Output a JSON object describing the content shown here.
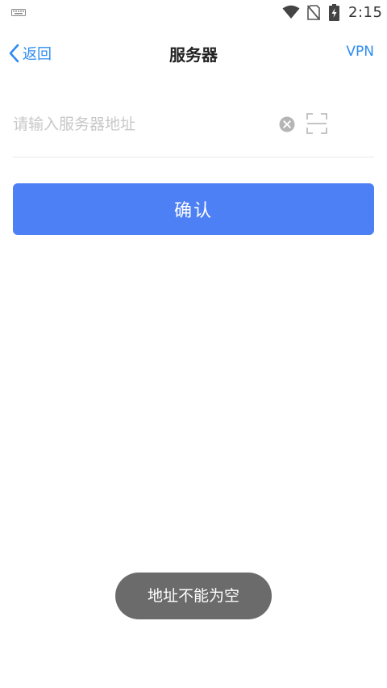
{
  "status_bar": {
    "time": "2:15",
    "icons": [
      "keyboard-icon",
      "wifi-icon",
      "no-sim-icon",
      "battery-charging-icon"
    ]
  },
  "nav": {
    "back_label": "返回",
    "back_icon": "chevron-left-icon",
    "title": "服务器",
    "vpn_label": "VPN"
  },
  "form": {
    "server_input": {
      "placeholder": "请输入服务器地址",
      "value": ""
    },
    "clear_icon": "clear-circle-icon",
    "scan_icon": "scan-icon",
    "confirm_label": "确认"
  },
  "toast": {
    "message": "地址不能为空"
  },
  "colors": {
    "accent": "#2d8cf0",
    "button": "#4e80f5",
    "toast_bg": "#6b6b6b",
    "placeholder": "#c8c8c8"
  }
}
